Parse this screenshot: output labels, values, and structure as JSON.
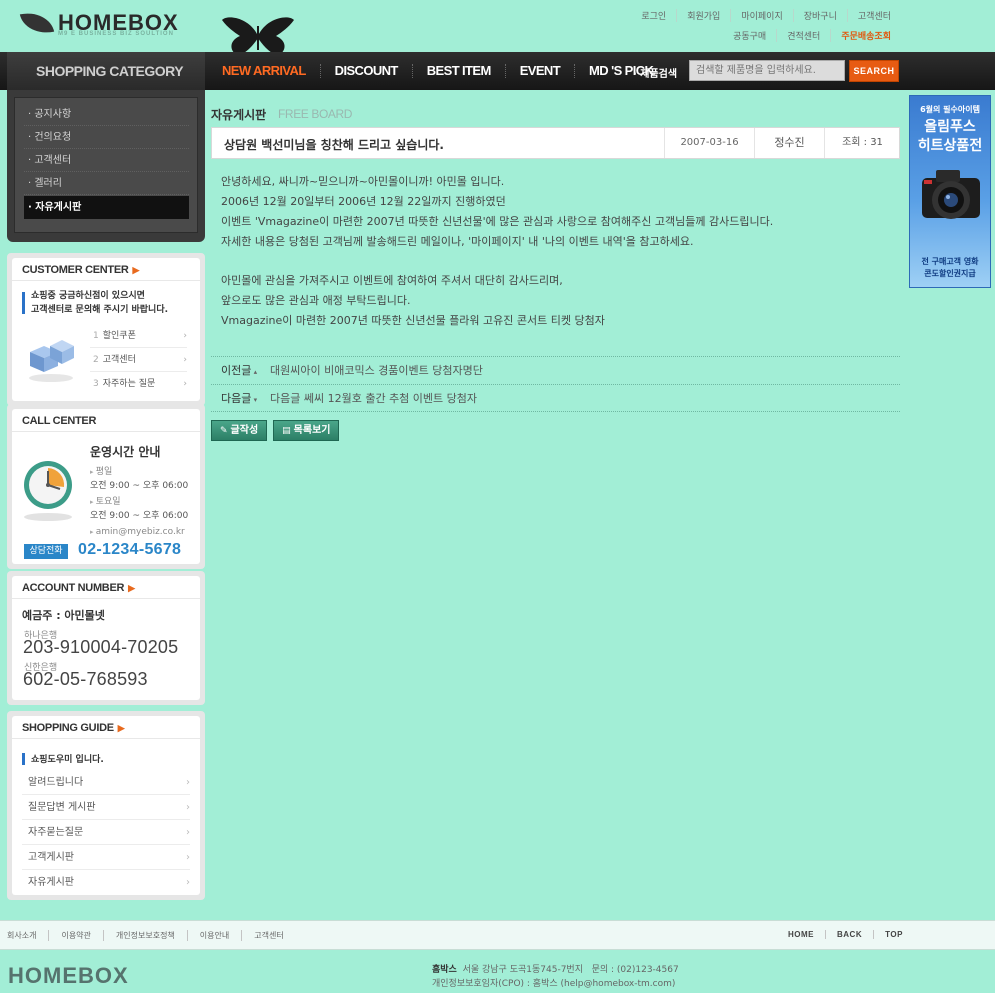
{
  "header": {
    "logo": "HOMEBOX",
    "logo_sub": "M9 E BUSINESS BIZ SOULTION",
    "top_links": [
      "로그인",
      "회원가입",
      "마이페이지",
      "장바구니",
      "고객센터"
    ],
    "top_links2": [
      "공동구매",
      "견적센터",
      "주문배송조회"
    ]
  },
  "nav": {
    "items": [
      "NEW ARRIVAL",
      "DISCOUNT",
      "BEST ITEM",
      "EVENT",
      "MD 'S PICK"
    ],
    "search_label": "· 제품검색",
    "search_placeholder": "검색할 제품명을 입력하세요.",
    "search_button": "SEARCH"
  },
  "category": {
    "title": "SHOPPING CATEGORY",
    "items": [
      "공지사항",
      "건의요청",
      "고객센터",
      "겔러리",
      "자유게시판"
    ]
  },
  "customer": {
    "title": "CUSTOMER CENTER",
    "text1": "쇼핑중 궁금하신점이 있으시면",
    "text2": "고객센터로 문의해 주시기 바랍니다.",
    "links": [
      {
        "num": "1",
        "label": "할인쿠폰"
      },
      {
        "num": "2",
        "label": "고객센터"
      },
      {
        "num": "3",
        "label": "자주하는 질문"
      }
    ]
  },
  "call": {
    "title": "CALL CENTER",
    "heading": "운영시간 안내",
    "weekday_label": "평일",
    "weekday_time": "오전 9:00 ~ 오후 06:00",
    "sat_label": "토요일",
    "sat_time": "오전 9:00 ~ 오후 06:00",
    "email": "amin@myebiz.co.kr",
    "phone_label": "상담전화",
    "phone": "02-1234-5678"
  },
  "account": {
    "title": "ACCOUNT NUMBER",
    "holder": "예금주 : 아민몰넷",
    "bank1": "하나은행",
    "num1": "203-910004-70205",
    "bank2": "신한은행",
    "num2": "602-05-768593"
  },
  "guide": {
    "title": "SHOPPING GUIDE",
    "text": "쇼핑도우미 입니다.",
    "items": [
      "알려드립니다",
      "질문답변 게시판",
      "자주묻는질문",
      "고객게시판",
      "자유게시판"
    ]
  },
  "board": {
    "title": "자유게시판",
    "title_en": "FREE BOARD",
    "subject": "상담원 백선미님을 칭찬해 드리고 싶습니다.",
    "date": "2007-03-16",
    "writer": "정수진",
    "hits": "조회 : 31",
    "body": [
      "안녕하세요, 싸니까~믿으니까~아민몰이니까! 아민몰 입니다.",
      "2006년 12월 20일부터 2006년 12월 22일까지 진행하였던",
      "이벤트 'Vmagazine이 마련한 2007년 따뜻한 신년선물'에 많은 관심과 사랑으로 참여해주신 고객님들께 감사드립니다.",
      "자세한 내용은 당첨된 고객님께 발송해드린 메일이나, '마이페이지' 내 '나의 이벤트 내역'을 참고하세요.",
      "아민몰에 관심을 가져주시고 이벤트에 참여하여 주셔서 대단히 감사드리며,",
      "앞으로도 많은 관심과 애정 부탁드립니다.",
      "Vmagazine이 마련한 2007년 따뜻한 신년선물 플라워 고유진 콘서트 티켓 당첨자"
    ],
    "prev_label": "이전글",
    "prev_title": "대원씨아이 비애코믹스 경품이벤트 당첨자명단",
    "next_label": "다음글",
    "next_title": "다음글  쎄씨 12월호 출간 추첨 이벤트 당첨자",
    "write_button": "글작성",
    "list_button": "목록보기"
  },
  "banner": {
    "top": "6월의 필수아이템",
    "title1": "올림푸스",
    "title2": "히트상품전",
    "bottom1": "전 구매고객 영화",
    "bottom2": "콘도할인권지급"
  },
  "footer": {
    "links": [
      "회사소개",
      "이용약관",
      "개인정보보호정책",
      "이용안내",
      "고객센터"
    ],
    "nav": [
      "HOME",
      "BACK",
      "TOP"
    ],
    "logo": "HOMEBOX",
    "company": "홈박스",
    "address": "서울 강남구 도곡1동745-7번지",
    "phone": "문의 : (02)123-4567",
    "cpo": "개인정보보호임자(CPO) : 홈박스 (help@homebox-tm.com)"
  }
}
